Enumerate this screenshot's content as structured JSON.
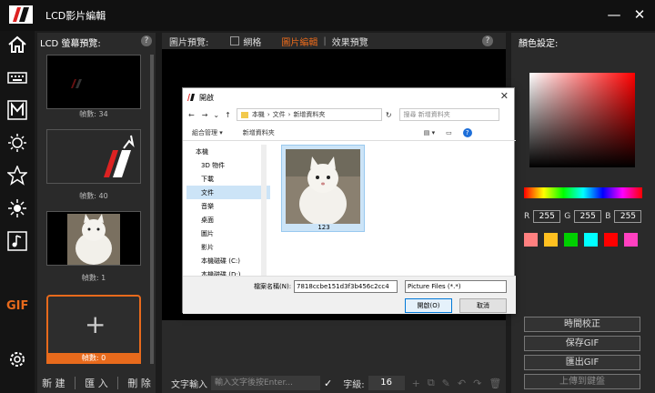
{
  "app": {
    "title": "LCD影片編輯"
  },
  "window": {
    "minimize": "—",
    "close": "✕"
  },
  "rail": {
    "gif_label": "GIF"
  },
  "lcd_panel": {
    "heading": "LCD 螢幕預覽:",
    "help": "?",
    "frames": [
      {
        "label": "幀數: 34"
      },
      {
        "label": "幀數: 40"
      },
      {
        "label": "幀數: 1"
      },
      {
        "label": "幀數: 0"
      }
    ],
    "add": "+",
    "buttons": {
      "new": "新 建",
      "import": "匯 入",
      "delete": "刪 除"
    }
  },
  "preview": {
    "heading": "圖片預覽:",
    "grid": "網格",
    "tab_image_edit": "圖片編輯",
    "tab_effect": "效果預覽",
    "help": "?",
    "text_input_label": "文字輸入",
    "text_input_placeholder": "輸入文字後按Enter...",
    "font_size_label": "字級:",
    "font_size": "16"
  },
  "color_panel": {
    "heading": "顏色設定:",
    "r_label": "R",
    "r": "255",
    "g_label": "G",
    "g": "255",
    "b_label": "B",
    "b": "255",
    "swatches": [
      "#ff8080",
      "#ffc020",
      "#00d000",
      "#00ffff",
      "#ff0000",
      "#ff40c0"
    ],
    "buttons": {
      "sync_time": "時間校正",
      "save_gif": "保存GIF",
      "export_gif": "匯出GIF",
      "upload": "上傳到鍵盤"
    }
  },
  "dialog": {
    "title": "開啟",
    "close": "✕",
    "address": [
      "本機",
      "文件",
      "新增資料夾"
    ],
    "search_placeholder": "搜尋 新增資料夾",
    "organize": "組合管理 ▾",
    "new_folder": "新增資料夾",
    "tree": [
      "本機",
      "3D 物件",
      "下載",
      "文件",
      "音樂",
      "桌面",
      "圖片",
      "影片",
      "本機磁碟 (C:)",
      "本機磁碟 (D:)"
    ],
    "selected_tree": "文件",
    "file": {
      "name": "123"
    },
    "filename_label": "檔案名稱(N):",
    "filename": "7818ccbe151d3f3b456c2cc4",
    "filetype": "Picture Files (*.*)",
    "open": "開啟(O)",
    "cancel": "取消"
  }
}
